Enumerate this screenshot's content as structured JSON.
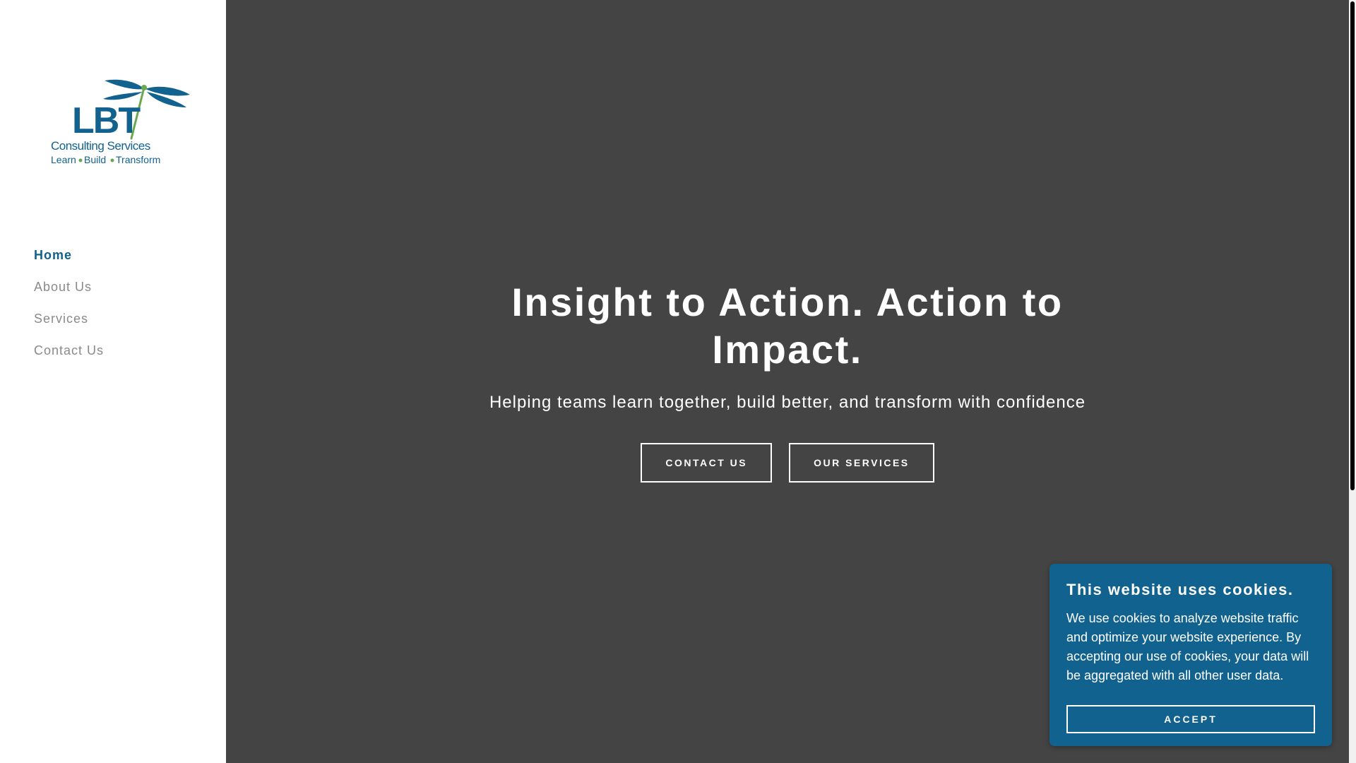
{
  "logo": {
    "wordmark": "LBT",
    "name": "Consulting Services",
    "tagline_learn": "Learn",
    "tagline_build": "Build",
    "tagline_transform": "Transform",
    "brand_blue": "#11628f",
    "brand_green": "#6aa84f"
  },
  "nav": {
    "items": [
      {
        "label": "Home",
        "active": true
      },
      {
        "label": "About Us",
        "active": false
      },
      {
        "label": "Services",
        "active": false
      },
      {
        "label": "Contact Us",
        "active": false
      }
    ]
  },
  "hero": {
    "title": "Insight to Action. Action to Impact.",
    "subtitle": "Helping teams learn together, build better, and transform with confidence",
    "contact_button": "CONTACT US",
    "services_button": "OUR SERVICES",
    "background": "#444444"
  },
  "cookie": {
    "title": "This website uses cookies.",
    "body": "We use cookies to analyze website traffic and optimize your website experience. By accepting our use of cookies, your data will be aggregated with all other user data.",
    "accept_button": "ACCEPT",
    "background": "#11628f"
  }
}
